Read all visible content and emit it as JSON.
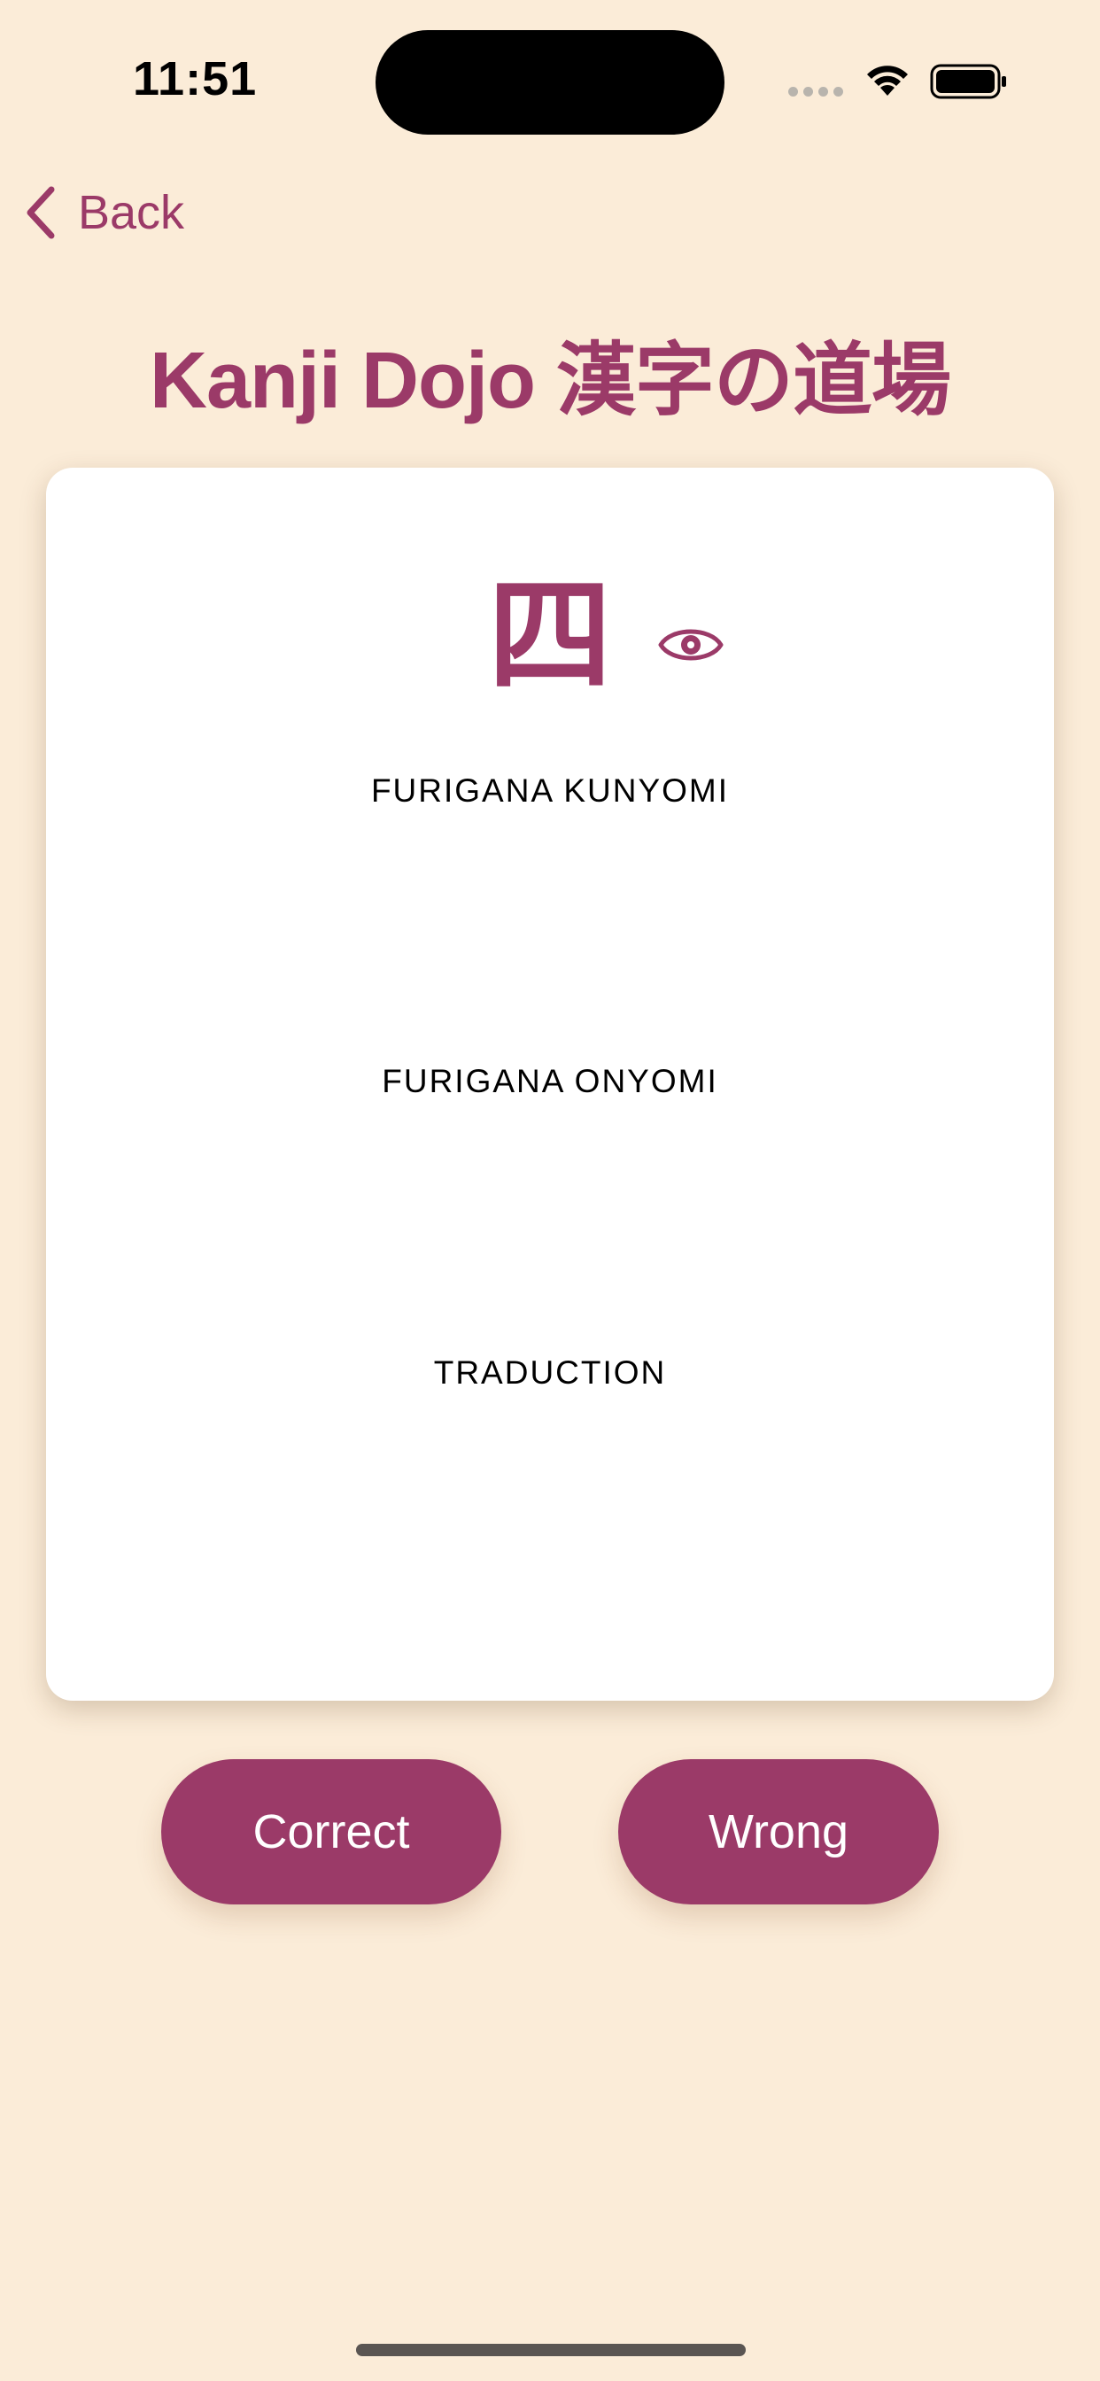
{
  "status_bar": {
    "time": "11:51"
  },
  "nav": {
    "back_label": "Back"
  },
  "header": {
    "title": "Kanji Dojo 漢字の道場"
  },
  "card": {
    "kanji": "四",
    "kunyomi_label": "FURIGANA KUNYOMI",
    "onyomi_label": "FURIGANA ONYOMI",
    "translation_label": "TRADUCTION"
  },
  "actions": {
    "correct_label": "Correct",
    "wrong_label": "Wrong"
  },
  "icons": {
    "back": "chevron-left-icon",
    "reveal": "eye-icon",
    "wifi": "wifi-icon",
    "battery": "battery-icon"
  },
  "colors": {
    "background": "#FBECD8",
    "accent": "#9B3A68",
    "card": "#FFFFFF"
  }
}
